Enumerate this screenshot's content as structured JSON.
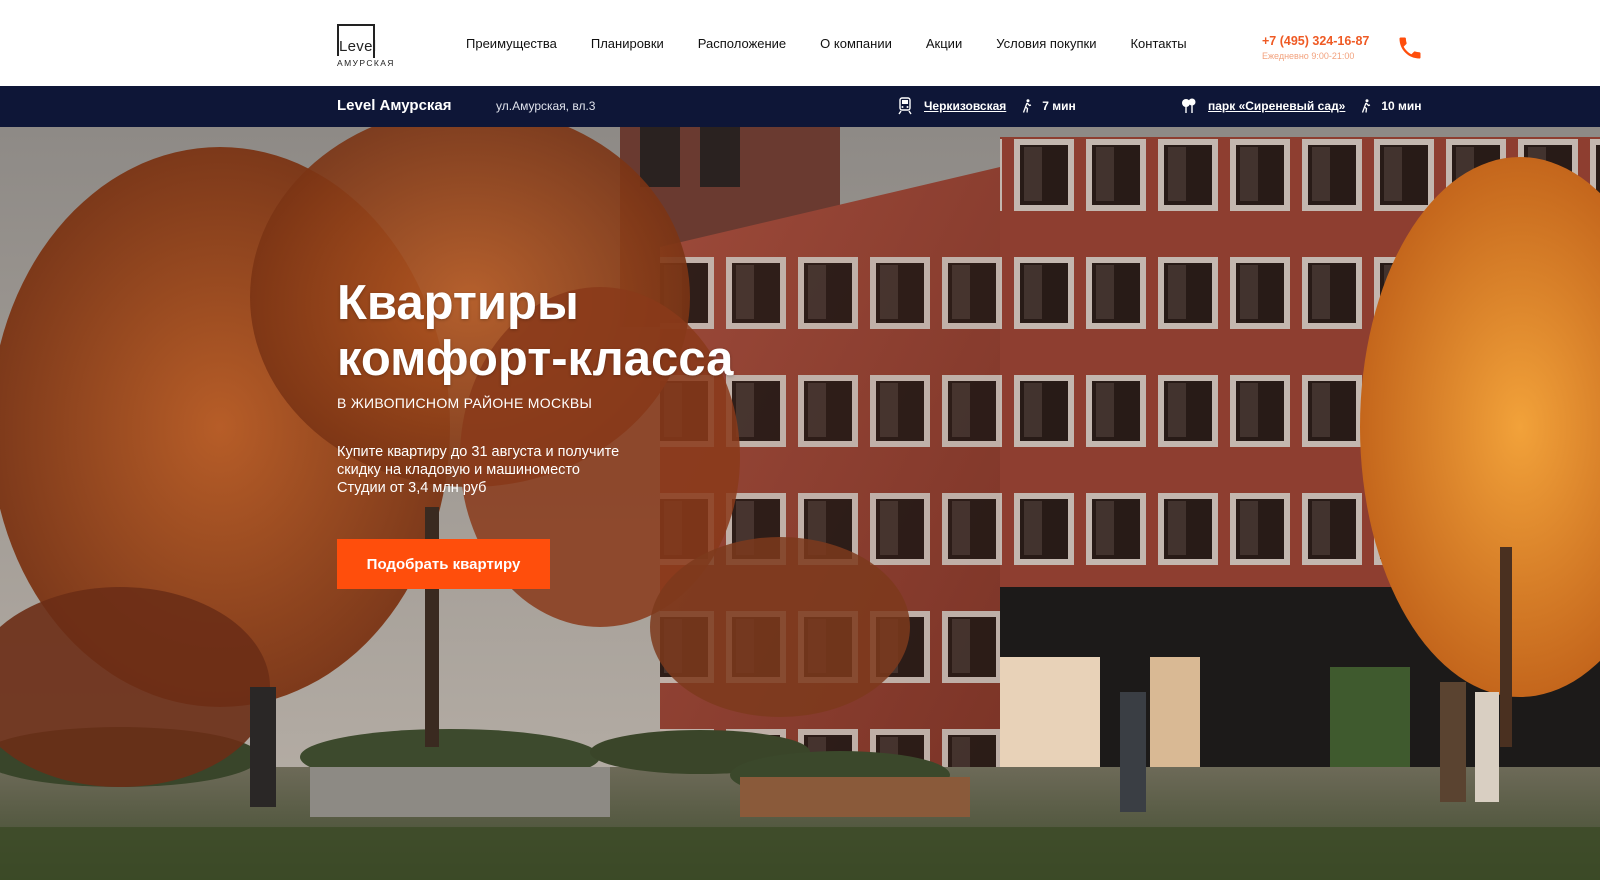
{
  "brand": {
    "logo_word": "Level",
    "logo_sub": "АМУРСКАЯ",
    "accent_color": "#ff4e0c",
    "nav_bg_color": "#0e1637"
  },
  "nav": {
    "items": [
      {
        "label": "Преимущества"
      },
      {
        "label": "Планировки"
      },
      {
        "label": "Расположение"
      },
      {
        "label": "О компании"
      },
      {
        "label": "Акции"
      },
      {
        "label": "Условия покупки"
      },
      {
        "label": "Контакты"
      }
    ]
  },
  "contact": {
    "phone": "+7 (495) 324-16-87",
    "hours": "Ежедневно 9:00-21:00",
    "icon": "phone-icon"
  },
  "infobar": {
    "title": "Level Амурская",
    "address": "ул.Амурская, вл.3",
    "metro": {
      "icon": "metro-train-icon",
      "label": "Черкизовская",
      "walk_icon": "walking-person-icon",
      "walk_time": "7 мин"
    },
    "park": {
      "icon": "park-tree-icon",
      "label": "парк «Сиреневый сад»",
      "walk_icon": "walking-person-icon",
      "walk_time": "10 мин"
    }
  },
  "hero": {
    "title_line1": "Квартиры",
    "title_line2": "комфорт-класса",
    "subtitle": "В ЖИВОПИСНОМ РАЙОНЕ МОСКВЫ",
    "text_line1": "Купите квартиру до 31 августа и получите",
    "text_line2": "скидку на кладовую и машиноместо",
    "text_line3": "Студии от 3,4 млн руб",
    "cta_label": "Подобрать квартиру"
  }
}
